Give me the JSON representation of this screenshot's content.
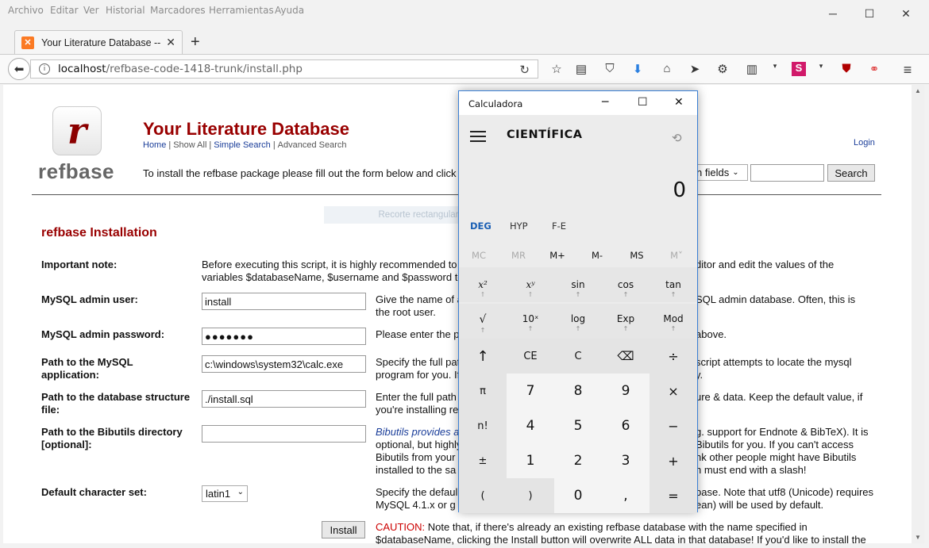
{
  "browser": {
    "menu": [
      "Archivo",
      "Editar",
      "Ver",
      "Historial",
      "Marcadores",
      "Herramientas",
      "Ayuda"
    ],
    "tab_title": "Your Literature Database -- I",
    "url_host": "localhost",
    "url_path": "/refbase-code-1418-trunk/install.php",
    "minimize": "─",
    "maximize": "☐",
    "close": "✕"
  },
  "site": {
    "logo_letter": "r",
    "logo_text": "refbase",
    "title": "Your Literature Database",
    "nav": {
      "home": "Home",
      "show_all": "Show All",
      "simple_search": "Simple Search",
      "advanced_search": "Advanced Search"
    },
    "login": "Login",
    "intro": "To install the refbase package please fill out the form below and click",
    "field_select": "n fields",
    "search_button": "Search",
    "snip_overlay": "Recorte rectangular"
  },
  "install": {
    "heading": "refbase Installation",
    "rows": [
      {
        "label": "Important note:",
        "desc": "Before executing this script, it is highly recommended to",
        "desc2": "variables $databaseName, $username and $password to",
        "desc_right": "ditor and edit the values of the"
      },
      {
        "label": "MySQL admin user:",
        "value": "install",
        "desc": "Give the name of a",
        "desc2": "the root user.",
        "desc_right": "SQL admin database. Often, this is"
      },
      {
        "label": "MySQL admin password:",
        "value": "●●●●●●●",
        "desc": "Please enter the p",
        "desc_right": "above."
      },
      {
        "label": "Path to the MySQL application:",
        "value": "c:\\windows\\system32\\calc.exe",
        "desc": "Specify the full pat",
        "desc2": "program for you. If",
        "desc_right": "script attempts to locate the mysql",
        "desc_right2": "y."
      },
      {
        "label": "Path to the database structure file:",
        "value": "./install.sql",
        "desc": "Enter the full path",
        "desc2": "you're installing re",
        "desc_right": "ure & data. Keep the default value, if"
      },
      {
        "label": "Path to the Bibutils directory [optional]:",
        "value": "",
        "desc": "Bibutils provides a",
        "desc2": "optional, but highly",
        "desc3": "Bibutils from your",
        "desc4": "installed to the sa",
        "desc_right": "g. support for Endnote & BibTeX). It is",
        "desc_right2": "Bibutils for you. If you can't access",
        "desc_right3": "nk other people might have Bibutils",
        "desc_right4": "h must end with a slash!"
      },
      {
        "label": "Default character set:",
        "value": "latin1",
        "desc": "Specify the defaul",
        "desc2": "MySQL 4.1.x or g",
        "desc_right": "base. Note that utf8 (Unicode) requires",
        "desc_right2": "ean) will be used by default."
      }
    ],
    "install_button": "Install",
    "caution_label": "CAUTION:",
    "caution_text": "Note that, if there's already an existing refbase database with the name specified in",
    "caution_text2": "$databaseName, clicking the Install button will overwrite ALL data in that database! If you'd like to install the"
  },
  "calculator": {
    "window_title": "Calculadora",
    "mode": "CIENTÍFICA",
    "display": "0",
    "angle_modes": [
      "DEG",
      "HYP",
      "F-E"
    ],
    "memory": [
      "MC",
      "MR",
      "M+",
      "M-",
      "MS",
      "M˅"
    ],
    "fn_row1": [
      "x²",
      "xʸ",
      "sin",
      "cos",
      "tan"
    ],
    "fn_row2": [
      "√",
      "10ˣ",
      "log",
      "Exp",
      "Mod"
    ],
    "keys": [
      [
        "↑",
        "CE",
        "C",
        "⌫",
        "÷"
      ],
      [
        "π",
        "7",
        "8",
        "9",
        "×"
      ],
      [
        "n!",
        "4",
        "5",
        "6",
        "−"
      ],
      [
        "±",
        "1",
        "2",
        "3",
        "+"
      ],
      [
        "(",
        ")",
        "0",
        ",",
        "="
      ]
    ]
  }
}
